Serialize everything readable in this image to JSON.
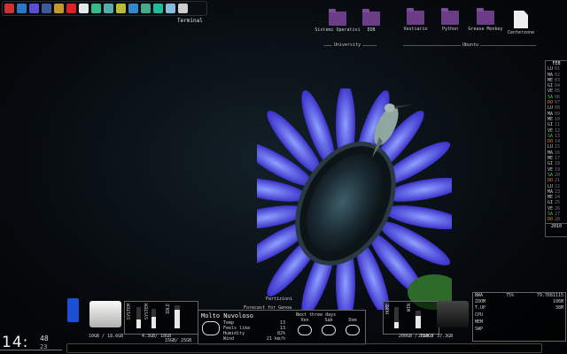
{
  "dock": {
    "icons": [
      "ubuntu-icon",
      "power-icon",
      "folder-icon",
      "film-icon",
      "terminal-icon",
      "opera-icon",
      "chrome-icon",
      "paint-icon",
      "text-icon",
      "photo-icon",
      "ftp-icon",
      "globe-icon",
      "messenger-icon",
      "weather-icon",
      "plane-icon"
    ]
  },
  "terminal_label": "Terminal",
  "folders_university": [
    {
      "label": "Sistemi Operativi"
    },
    {
      "label": "EDB"
    }
  ],
  "folders_ubuntu": [
    {
      "label": "Vestiario"
    },
    {
      "label": "Python"
    },
    {
      "label": "Grease Monkey"
    },
    {
      "label": "Centerzone"
    }
  ],
  "groups": {
    "university": "University",
    "ubuntu": "Ubuntu"
  },
  "calendar": {
    "month": "FEB",
    "year": "2010",
    "days": [
      [
        "LU",
        "01"
      ],
      [
        "MA",
        "02"
      ],
      [
        "ME",
        "03"
      ],
      [
        "GI",
        "04"
      ],
      [
        "VE",
        "05"
      ],
      [
        "SA",
        "06"
      ],
      [
        "DO",
        "07"
      ],
      [
        "LU",
        "08"
      ],
      [
        "MA",
        "09"
      ],
      [
        "ME",
        "10"
      ],
      [
        "GI",
        "11"
      ],
      [
        "VE",
        "12"
      ],
      [
        "SA",
        "13"
      ],
      [
        "DO",
        "14"
      ],
      [
        "LU",
        "15"
      ],
      [
        "MA",
        "16"
      ],
      [
        "ME",
        "17"
      ],
      [
        "GI",
        "18"
      ],
      [
        "VE",
        "19"
      ],
      [
        "SA",
        "20"
      ],
      [
        "DO",
        "21"
      ],
      [
        "LU",
        "22"
      ],
      [
        "MA",
        "23"
      ],
      [
        "ME",
        "24"
      ],
      [
        "GI",
        "25"
      ],
      [
        "VE",
        "26"
      ],
      [
        "SA",
        "27"
      ],
      [
        "DO",
        "28"
      ]
    ]
  },
  "clock": {
    "hour_min": "14:",
    "time": "14",
    "sec": "48",
    "min": "23"
  },
  "disk": {
    "left_usage": "10GB / 18.6GB",
    "right_usage": "26GB / 37.3GB",
    "partitions_label": "Partizioni"
  },
  "system": {
    "label_left": "SYSTEM",
    "label_sys": "SYSTEM",
    "values": [
      "4.3GB/ 18GB",
      "15GB/ 25GB"
    ],
    "idle": "IDLE"
  },
  "weather": {
    "header": "Forecast for Genoa",
    "condition": "Molto Nuvoloso",
    "rows": [
      {
        "k": "Temp",
        "v": "13"
      },
      {
        "k": "Feels like",
        "v": "13"
      },
      {
        "k": "Humidity",
        "v": "82%"
      },
      {
        "k": "Wind",
        "v": "21 km/h"
      }
    ],
    "next_label": "Next three days",
    "days": [
      "Ven",
      "Sab",
      "Dom"
    ]
  },
  "right_disk": {
    "labels": [
      "HOME",
      "WIN"
    ],
    "values": [
      "200GB / 734GB"
    ]
  },
  "net": {
    "rows": [
      {
        "k": "NWA",
        "v": "75%",
        "v2": "79.7681115"
      },
      {
        "k": "ZOOM",
        "v": "",
        "v2": "106M"
      },
      {
        "k": "T.UP",
        "v": "",
        "v2": "38M"
      }
    ],
    "cpu_labels": [
      "CPU",
      "MEM",
      "SWP"
    ]
  }
}
